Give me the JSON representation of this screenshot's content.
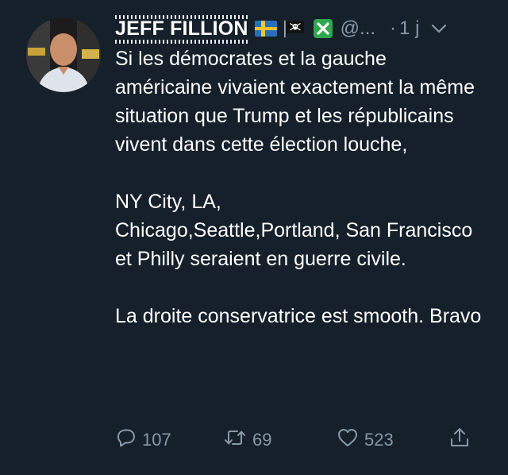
{
  "tweet": {
    "author": {
      "display_name": "JEFF FILLION",
      "handle": "@...",
      "emojis": [
        "sweden-flag-icon",
        "pirate-flag-icon",
        "cross-mark-icon"
      ]
    },
    "separator": "·",
    "timestamp": "1 j",
    "body": {
      "paragraph_1": "Si les démocrates et la gauche américaine vivaient exactement la même situation que Trump et les républicains vivent dans cette élection louche,",
      "paragraph_2_line_1": "NY City, LA,",
      "paragraph_2_line_2": "Chicago,Seattle,Portland, San Francisco et Philly seraient en guerre civile.",
      "paragraph_3": "La droite conservatrice est smooth. Bravo"
    },
    "actions": {
      "replies": "107",
      "retweets": "69",
      "likes": "523"
    }
  },
  "colors": {
    "background": "#15202b",
    "text": "#ffffff",
    "secondary": "#8899a6"
  }
}
